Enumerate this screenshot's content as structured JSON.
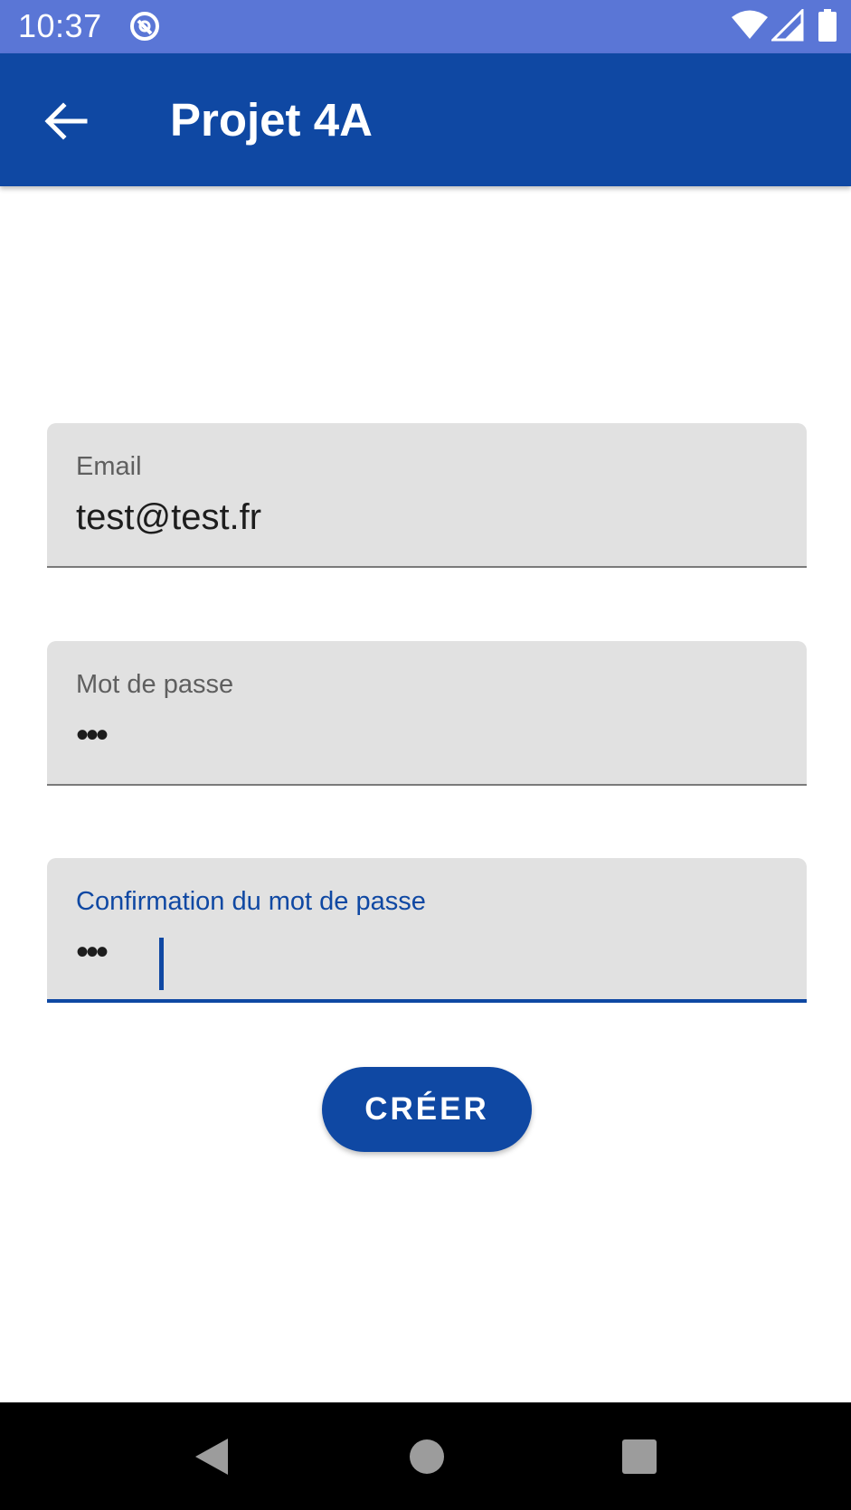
{
  "status_bar": {
    "time": "10:37",
    "background_color": "#5A76D6",
    "icons": [
      "notification-icon",
      "wifi-icon",
      "signal-icon",
      "battery-icon"
    ]
  },
  "app_bar": {
    "title": "Projet 4A",
    "background_color": "#0F48A3",
    "back_icon": "arrow-back-icon"
  },
  "form": {
    "email": {
      "label": "Email",
      "value": "test@test.fr"
    },
    "password": {
      "label": "Mot de passe",
      "value": "•••"
    },
    "confirm_password": {
      "label": "Confirmation du mot de passe",
      "value": "•••",
      "focused": true
    },
    "submit_label": "CRÉER"
  },
  "nav_bar": {
    "icons": [
      "nav-back-icon",
      "nav-home-icon",
      "nav-recents-icon"
    ]
  },
  "colors": {
    "accent": "#0F48A3",
    "field_background": "#E1E1E1"
  }
}
